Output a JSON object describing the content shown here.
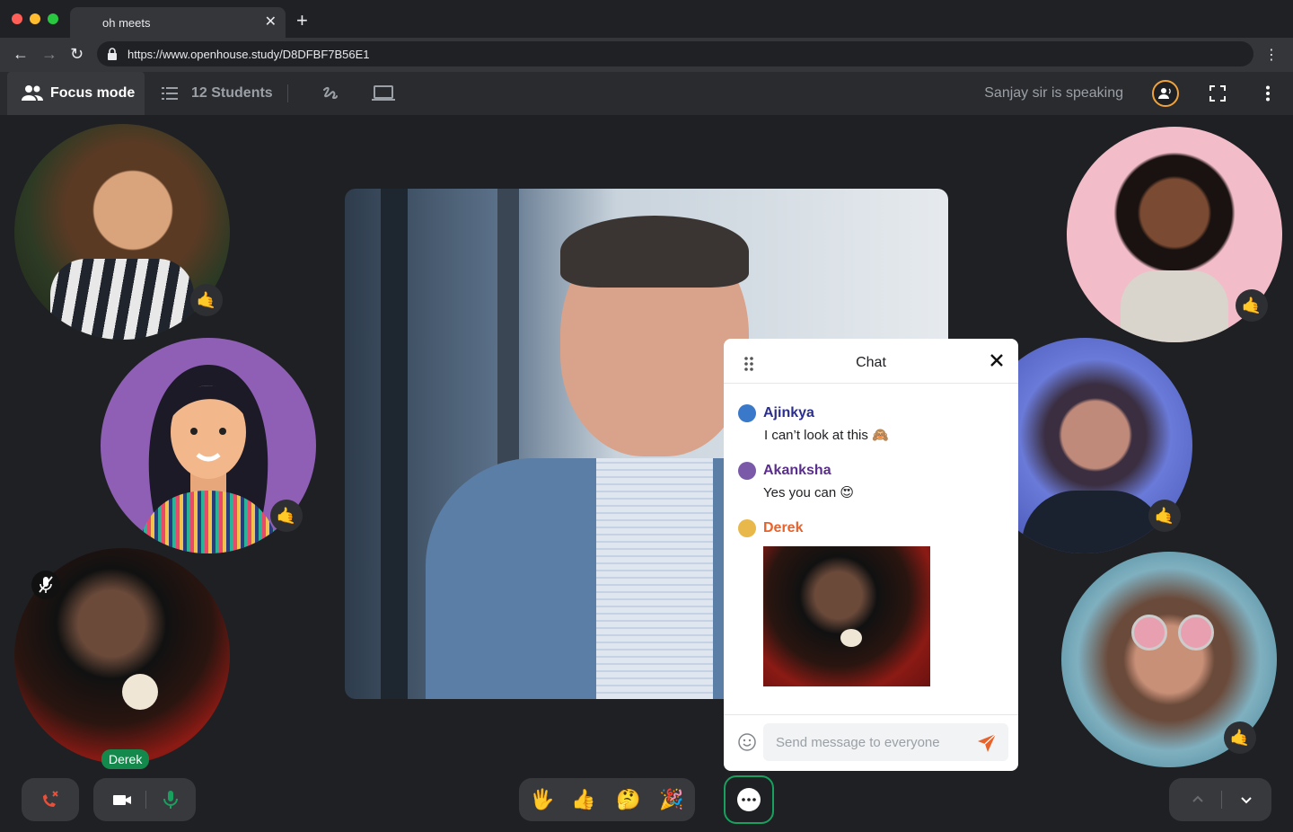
{
  "browser": {
    "tab_title": "oh meets",
    "url": "https://www.openhouse.study/D8DFBF7B56E1"
  },
  "toolbar": {
    "focus_mode_label": "Focus mode",
    "students_label": "12 Students",
    "speaking_label": "Sanjay sir is speaking"
  },
  "participants": {
    "derek_name": "Derek"
  },
  "chat": {
    "title": "Chat",
    "messages": [
      {
        "name": "Ajinkya",
        "text": "I can’t look at this 🙈",
        "color": "#2b2e8c"
      },
      {
        "name": "Akanksha",
        "text": "Yes you can 😍",
        "color": "#5a2e8c"
      },
      {
        "name": "Derek",
        "text": "",
        "color": "#e8622c"
      }
    ],
    "input_placeholder": "Send message to everyone"
  },
  "reactions": {
    "wave": "🖐",
    "thumbs_up": "👍",
    "thinking": "🤔",
    "party": "🎉",
    "call_me": "🤙"
  },
  "colors": {
    "accent_green": "#18a05e",
    "speaker_ring": "#f0a23b",
    "send_orange": "#e8622c"
  }
}
